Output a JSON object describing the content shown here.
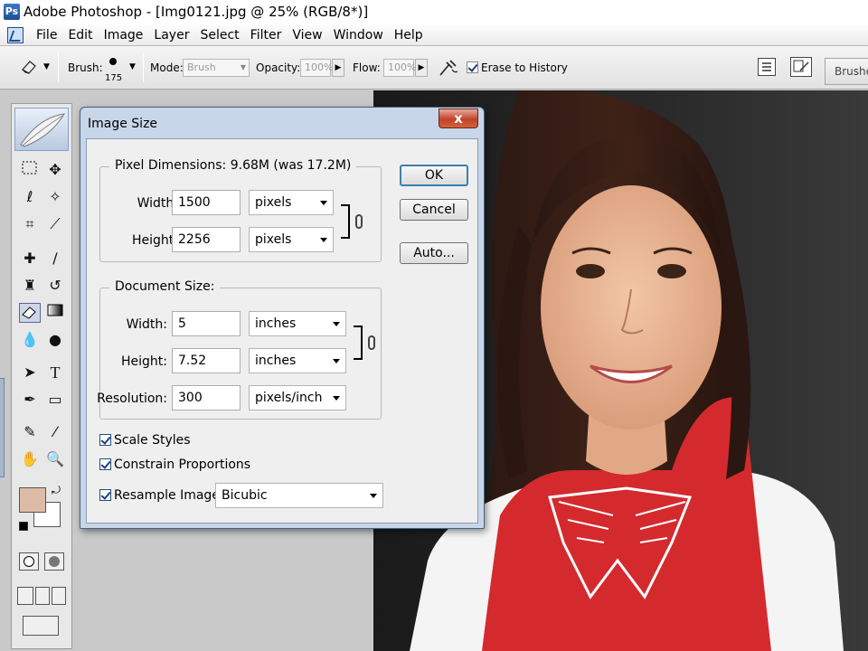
{
  "window": {
    "title": "Adobe Photoshop - [Img0121.jpg @ 25% (RGB/8*)]"
  },
  "menu": [
    "File",
    "Edit",
    "Image",
    "Layer",
    "Select",
    "Filter",
    "View",
    "Window",
    "Help"
  ],
  "options": {
    "brush_label": "Brush:",
    "brush_size": "175",
    "mode_label": "Mode:",
    "mode_value": "Brush",
    "opacity_label": "Opacity:",
    "opacity_value": "100%",
    "flow_label": "Flow:",
    "flow_value": "100%",
    "erase_history": "Erase to History",
    "brushes_tab": "Brushes"
  },
  "dialog": {
    "title": "Image Size",
    "close": "x",
    "pixel_dimensions": {
      "legend": "Pixel Dimensions:  9.68M (was 17.2M)",
      "width_label": "Width:",
      "width_value": "1500",
      "width_unit": "pixels",
      "height_label": "Height:",
      "height_value": "2256",
      "height_unit": "pixels"
    },
    "document_size": {
      "legend": "Document Size:",
      "width_label": "Width:",
      "width_value": "5",
      "width_unit": "inches",
      "height_label": "Height:",
      "height_value": "7.52",
      "height_unit": "inches",
      "resolution_label": "Resolution:",
      "resolution_value": "300",
      "resolution_unit": "pixels/inch"
    },
    "buttons": {
      "ok": "OK",
      "cancel": "Cancel",
      "auto": "Auto..."
    },
    "checks": {
      "scale_styles": "Scale Styles",
      "constrain": "Constrain Proportions",
      "resample": "Resample Image:",
      "resample_method": "Bicubic"
    }
  },
  "colors": {
    "foreground": "#dcbca6",
    "background": "#ffffff",
    "shirt": "#d42a2e"
  }
}
